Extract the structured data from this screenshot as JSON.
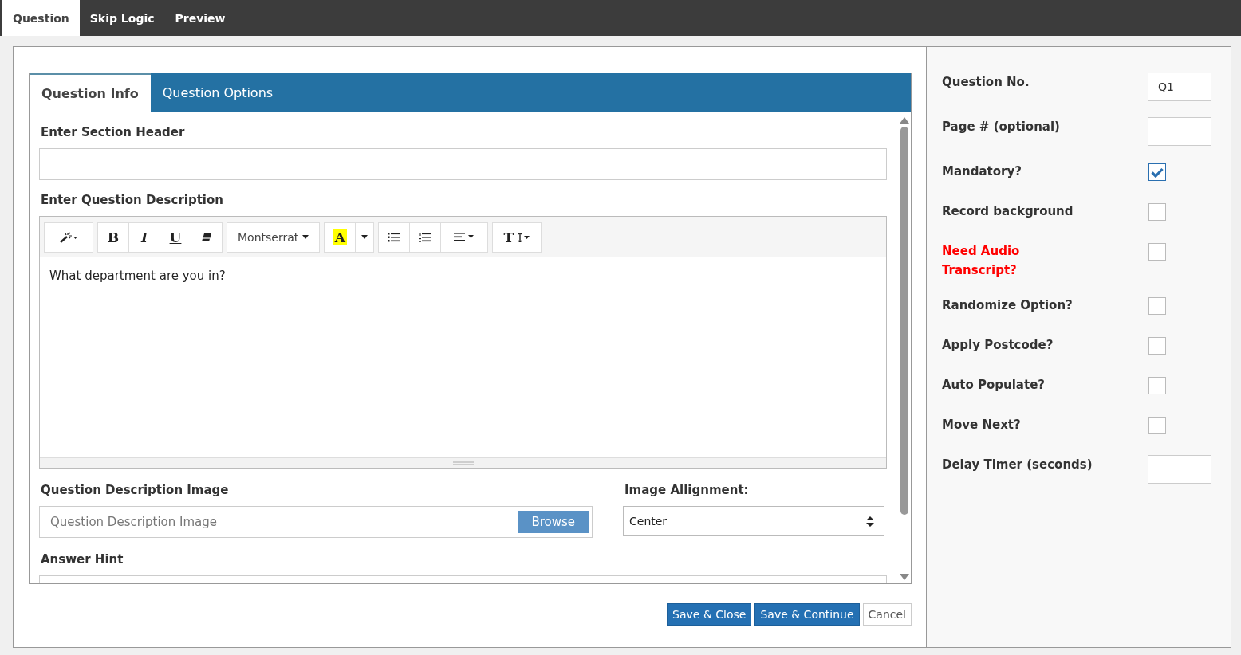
{
  "top_tabs": [
    {
      "label": "Question",
      "selected": true
    },
    {
      "label": "Skip Logic",
      "selected": false
    },
    {
      "label": "Preview",
      "selected": false
    }
  ],
  "panel_tabs": [
    {
      "label": "Question Info",
      "selected": true
    },
    {
      "label": "Question Options",
      "selected": false
    }
  ],
  "section_header": {
    "label": "Enter Section Header"
  },
  "description": {
    "label": "Enter Question Description",
    "text": "What department are you in?",
    "toolbar": [
      [
        {
          "kind": "wand"
        }
      ],
      [
        {
          "kind": "bold",
          "label": "B"
        },
        {
          "kind": "italic",
          "label": "I"
        },
        {
          "kind": "underline",
          "label": "U"
        },
        {
          "kind": "eraser"
        }
      ],
      [
        {
          "kind": "font",
          "label": "Montserrat"
        }
      ],
      [
        {
          "kind": "highlight",
          "label": "A"
        },
        {
          "kind": "caret"
        }
      ],
      [
        {
          "kind": "ul"
        },
        {
          "kind": "ol"
        },
        {
          "kind": "align"
        }
      ],
      [
        {
          "kind": "size",
          "label": "T"
        }
      ]
    ]
  },
  "image": {
    "label": "Question Description Image",
    "placeholder": "Question Description Image",
    "button": "Browse"
  },
  "alignment": {
    "label": "Image Allignment:",
    "value": "Center"
  },
  "answer_hint": {
    "label": "Answer Hint"
  },
  "actions": [
    {
      "label": "Save & Close",
      "kind": "primary"
    },
    {
      "label": "Save & Continue",
      "kind": "primary"
    },
    {
      "label": "Cancel",
      "kind": "plain"
    }
  ],
  "settings": [
    {
      "label": "Question No.",
      "kind": "text",
      "value": "Q1",
      "color": "#333333"
    },
    {
      "label": "Page # (optional)",
      "kind": "text",
      "color": "#333333"
    },
    {
      "label": "Mandatory?",
      "kind": "checkbox",
      "checked": true,
      "color": "#333333"
    },
    {
      "label": "Record background",
      "kind": "checkbox",
      "checked": false,
      "color": "#333333"
    },
    {
      "label": "Need Audio\nTranscript?",
      "kind": "checkbox",
      "checked": false,
      "color": "#ff0000"
    },
    {
      "label": "Randomize Option?",
      "kind": "checkbox",
      "checked": false,
      "color": "#333333"
    },
    {
      "label": "Apply Postcode?",
      "kind": "checkbox",
      "checked": false,
      "color": "#333333"
    },
    {
      "label": "Auto Populate?",
      "kind": "checkbox",
      "checked": false,
      "color": "#333333"
    },
    {
      "label": "Move Next?",
      "kind": "checkbox",
      "checked": false,
      "color": "#333333"
    },
    {
      "label": "Delay Timer (seconds)",
      "kind": "text",
      "color": "#333333"
    }
  ]
}
